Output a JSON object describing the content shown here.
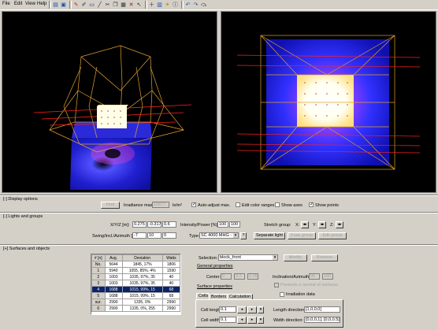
{
  "menu": {
    "file": "File",
    "edit": "Edit",
    "view": "View",
    "help": "Help"
  },
  "toolbar": {
    "icons": [
      "open-icon",
      "save-icon",
      "wand-icon",
      "pen-icon",
      "rect-icon",
      "line-icon",
      "cut-icon",
      "copy-icon",
      "paste-icon",
      "delete-icon",
      "pointer-icon",
      "add-icon",
      "grid-icon",
      "light-icon",
      "undo-icon",
      "redo-icon",
      "info-icon"
    ]
  },
  "display_options": {
    "header": "[-] Display options",
    "find_button": "Find",
    "irradiance_label": "Irradiance max:",
    "irradiance_value": "10677",
    "irradiance_unit": "lx/m²",
    "auto_adjust": "Auto-adjust max.",
    "edit_color": "Edit color ranges",
    "show_axes": "Show axes",
    "show_points": "Show points"
  },
  "lights": {
    "header": "[-] Lights and groups",
    "xyz_label": "X/Y/Z [m]:",
    "xyz": [
      "0.275",
      "-0.317",
      "0.6"
    ],
    "swing_label": "Swing/Incl./Azimuth [°]:",
    "swing": [
      "-7",
      "10",
      "0"
    ],
    "intensity_label": "Intensity/Power [%]:",
    "intensity": [
      "100",
      "100"
    ],
    "type_label": "Type:",
    "type_value": "SC 4000 MHG - 20",
    "type_btn": "?",
    "stretch_label": "Stretch group:",
    "stretch_x": "X:",
    "stretch_y": "Y:",
    "stretch_z": "Z:",
    "separate": "Separate light",
    "fuse": "Fuse group",
    "edit_group": "Edit group"
  },
  "surfaces": {
    "header": "[+] Surfaces and objects",
    "table_headers": [
      "# [n]",
      "Avg.",
      "Deviation",
      "Watts"
    ],
    "rows": [
      [
        "No.",
        "5644",
        "1845, 17%",
        "1806"
      ],
      [
        "1",
        "5940",
        "1055, 85%, 4%",
        "1590"
      ],
      [
        "2",
        "1003",
        "1035, 97%, 35",
        "40"
      ],
      [
        "3",
        "1003",
        "1035, 97%, 35",
        "40"
      ],
      [
        "4",
        "1688",
        "1015, 99%, 15",
        "68"
      ],
      [
        "5",
        "1688",
        "1015, 99%, 15",
        "68"
      ],
      [
        "sur.",
        "2990",
        "1335, 0%",
        "2990"
      ],
      [
        "6",
        "2990",
        "1335, 0%, 255",
        "2990"
      ]
    ],
    "selected_row": 4,
    "selection_label": "Selection:",
    "selection_value": "block_front",
    "modify_btn": "Modify",
    "remove_btn": "Remove",
    "general_props": "General properties",
    "center_label": "Center:",
    "center": [
      "0",
      "0.2",
      "0.05"
    ],
    "incl_label": "Inclination/Azimuth:",
    "incl": [
      "90",
      "180"
    ],
    "tilt_label": "Presents a normal of surfaces",
    "irr_data": "Irradiation data",
    "surface_props": "Surface properties",
    "tabs": [
      "Cells",
      "Borders",
      "Calculation"
    ],
    "cell_length_label": "Cell length:",
    "cell_length": "0.1",
    "cell_width_label": "Cell width:",
    "cell_width": "0.1",
    "length_dir_label": "Length direction:",
    "length_dir": "[1,0,0,0]",
    "width_dir_label": "Width direction:",
    "width_dir": "[0,0,0,1], [0,0,0.5]"
  }
}
